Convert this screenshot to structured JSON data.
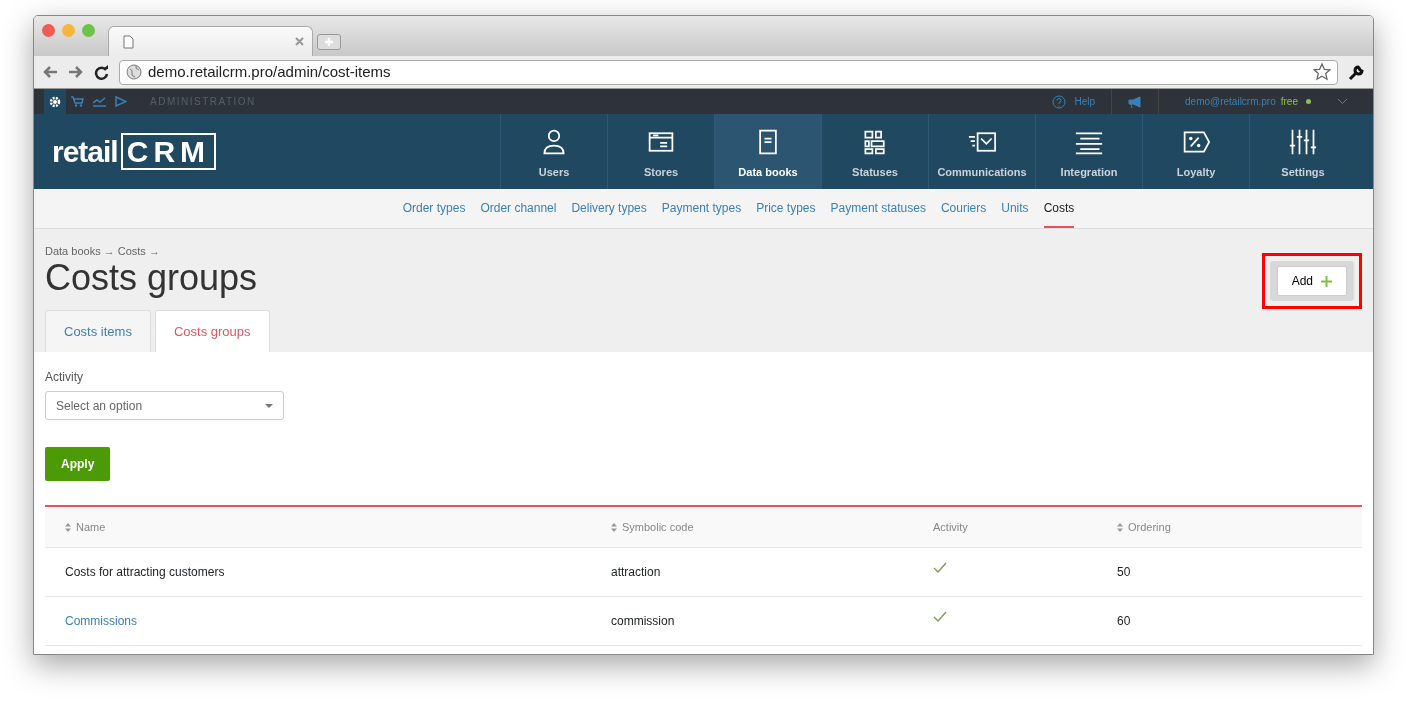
{
  "browser": {
    "url": "demo.retailcrm.pro/admin/cost-items"
  },
  "topbar": {
    "section": "ADMINISTRATION",
    "help": "Help",
    "user": "demo@retailcrm.pro",
    "plan": "free"
  },
  "logo": {
    "text": "retail",
    "mark": "CRM"
  },
  "main_nav": [
    {
      "label": "Users",
      "selected": false
    },
    {
      "label": "Stores",
      "selected": false
    },
    {
      "label": "Data books",
      "selected": true
    },
    {
      "label": "Statuses",
      "selected": false
    },
    {
      "label": "Communications",
      "selected": false
    },
    {
      "label": "Integration",
      "selected": false
    },
    {
      "label": "Loyalty",
      "selected": false
    },
    {
      "label": "Settings",
      "selected": false
    }
  ],
  "sub_nav": [
    {
      "label": "Order types",
      "selected": false
    },
    {
      "label": "Order channel",
      "selected": false
    },
    {
      "label": "Delivery types",
      "selected": false
    },
    {
      "label": "Payment types",
      "selected": false
    },
    {
      "label": "Price types",
      "selected": false
    },
    {
      "label": "Payment statuses",
      "selected": false
    },
    {
      "label": "Couriers",
      "selected": false
    },
    {
      "label": "Units",
      "selected": false
    },
    {
      "label": "Costs",
      "selected": true
    }
  ],
  "breadcrumbs": "Data books → Costs →",
  "title": "Costs groups",
  "add_button": {
    "label": "Add",
    "highlighted": true
  },
  "tabs": [
    {
      "label": "Costs items",
      "selected": false
    },
    {
      "label": "Costs groups",
      "selected": true
    }
  ],
  "filter": {
    "label": "Activity",
    "placeholder": "Select an option"
  },
  "apply_button": "Apply",
  "table": {
    "columns": [
      {
        "label": "Name",
        "sortable": true
      },
      {
        "label": "Symbolic code",
        "sortable": true
      },
      {
        "label": "Activity",
        "sortable": false
      },
      {
        "label": "Ordering",
        "sortable": true
      }
    ],
    "rows": [
      {
        "name": "Costs for attracting customers",
        "link": false,
        "code": "attraction",
        "active": true,
        "ordering": "50"
      },
      {
        "name": "Commissions",
        "link": true,
        "code": "commission",
        "active": true,
        "ordering": "60"
      }
    ]
  }
}
